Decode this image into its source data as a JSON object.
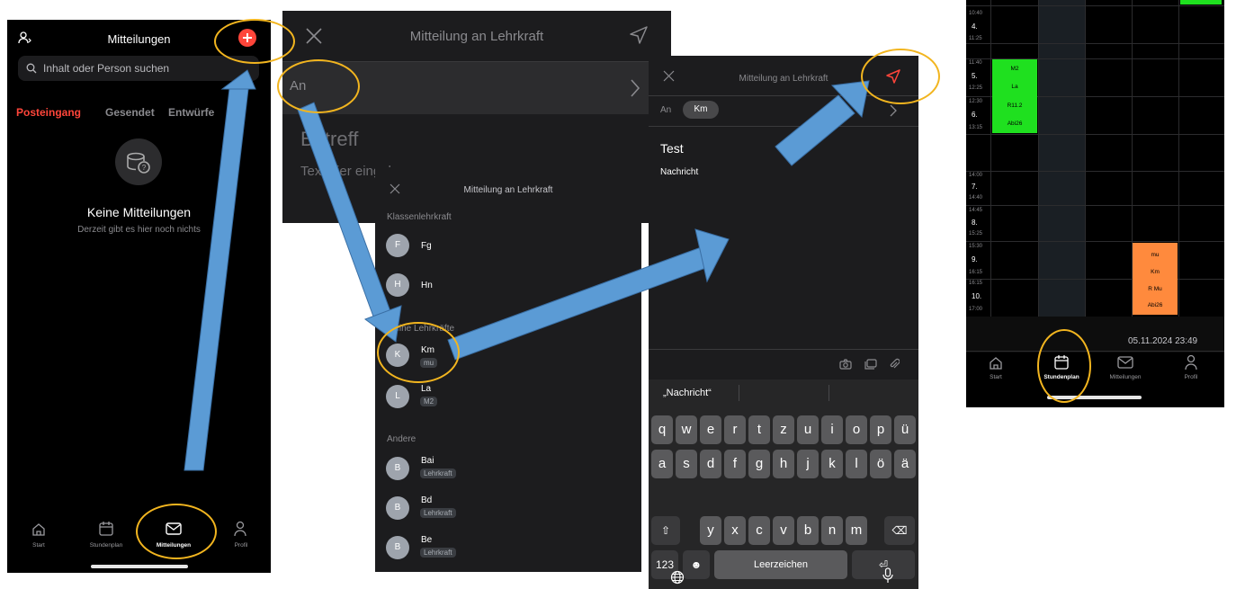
{
  "screen1": {
    "title": "Mitteilungen",
    "search_placeholder": "Inhalt oder Person suchen",
    "tabs": [
      "Posteingang",
      "Gesendet",
      "Entwürfe"
    ],
    "empty_title": "Keine Mitteilungen",
    "empty_subtitle": "Derzeit gibt es hier noch nichts",
    "nav": [
      "Start",
      "Stundenplan",
      "Mitteilungen",
      "Profil"
    ],
    "accent": "#ff453a"
  },
  "screen2": {
    "title": "Mitteilung an Lehrkraft",
    "to_label": "An",
    "subject_placeholder": "Betreff",
    "text_placeholder": "Text hier eingeben"
  },
  "screen3": {
    "title": "Mitteilung an Lehrkraft",
    "sections": {
      "class_teacher": "Klassenlehrkraft",
      "my_teachers": "Meine Lehrkräfte",
      "others": "Andere"
    },
    "class_teachers": [
      {
        "initial": "F",
        "name": "Fg"
      },
      {
        "initial": "H",
        "name": "Hn"
      }
    ],
    "my_teachers": [
      {
        "initial": "K",
        "name": "Km",
        "chip": "mu"
      },
      {
        "initial": "L",
        "name": "La",
        "chip": "M2"
      }
    ],
    "others": [
      {
        "initial": "B",
        "name": "Bai",
        "chip": "Lehrkraft"
      },
      {
        "initial": "B",
        "name": "Bd",
        "chip": "Lehrkraft"
      },
      {
        "initial": "B",
        "name": "Be",
        "chip": "Lehrkraft"
      }
    ]
  },
  "screen4": {
    "title": "Mitteilung an Lehrkraft",
    "to_label": "An",
    "recipient": "Km",
    "subject": "Test",
    "body": "Nachricht",
    "suggestion": "„Nachricht“",
    "keyboard_rows": [
      [
        "q",
        "w",
        "e",
        "r",
        "t",
        "z",
        "u",
        "i",
        "o",
        "p",
        "ü"
      ],
      [
        "a",
        "s",
        "d",
        "f",
        "g",
        "h",
        "j",
        "k",
        "l",
        "ö",
        "ä"
      ],
      [
        "y",
        "x",
        "c",
        "v",
        "b",
        "n",
        "m"
      ]
    ],
    "numbers_key": "123",
    "space_key": "Leerzeichen"
  },
  "screen5": {
    "periods": [
      {
        "start": "10:40",
        "num": "4.",
        "end": "11:25"
      },
      {
        "start": "11:40",
        "num": "5.",
        "end": "12:25"
      },
      {
        "start": "12:30",
        "num": "6.",
        "end": "13:15"
      },
      {
        "start": "14:00",
        "num": "7.",
        "end": "14:40"
      },
      {
        "start": "14:45",
        "num": "8.",
        "end": "15:25"
      },
      {
        "start": "15:30",
        "num": "9.",
        "end": "16:15"
      },
      {
        "start": "16:15",
        "num": "10.",
        "end": "17:00"
      }
    ],
    "green_lesson": [
      "M2",
      "La",
      "R11.2",
      "Abi26"
    ],
    "orange_lesson": [
      "mu",
      "Km",
      "R Mu",
      "Abi26"
    ],
    "timestamp": "05.11.2024 23:49",
    "nav": [
      "Start",
      "Stundenplan",
      "Mitteilungen",
      "Profil"
    ],
    "green": "#1fe01f",
    "orange": "#ff8a3d"
  },
  "annotation_color": "#f2b51f",
  "arrow_color": "#5b9bd5"
}
